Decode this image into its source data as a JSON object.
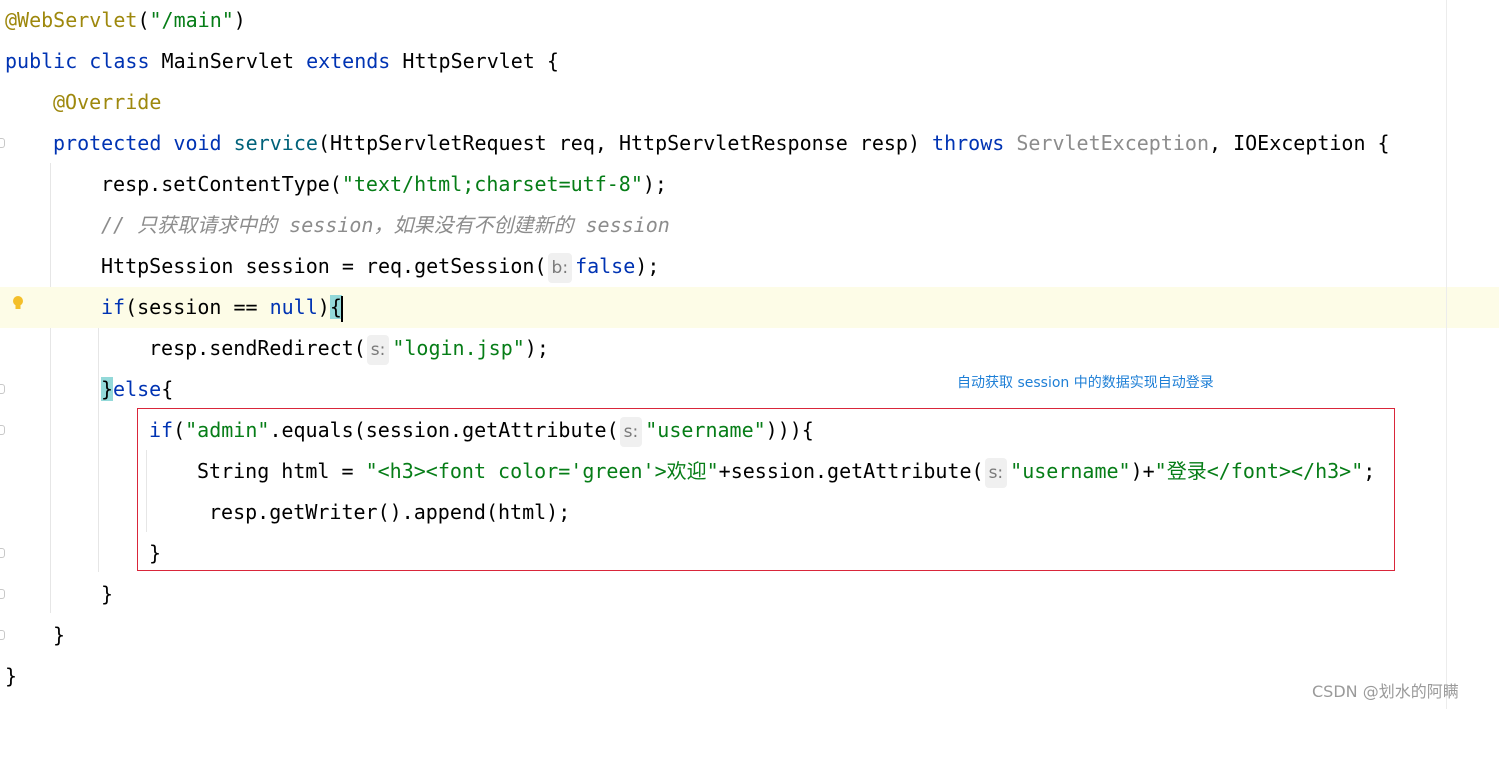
{
  "code": {
    "l1_annotation": "@WebServlet",
    "l1_paren_open": "(",
    "l1_string": "\"/main\"",
    "l1_paren_close": ")",
    "l2_public": "public",
    "l2_class": "class",
    "l2_name": " MainServlet ",
    "l2_extends": "extends",
    "l2_rest": " HttpServlet {",
    "l3_override": "@Override",
    "l4_protected": "protected",
    "l4_void": "void",
    "l4_method": "service",
    "l4_params": "(HttpServletRequest req, HttpServletResponse resp) ",
    "l4_throws": "throws",
    "l4_servlet_exception": "ServletException",
    "l4_rest": ", IOException {",
    "l5_call": "resp.setContentType(",
    "l5_string": "\"text/html;charset=utf-8\"",
    "l5_end": ");",
    "l6_comment": "// 只获取请求中的 session，如果没有不创建新的 session",
    "l7_start": "HttpSession session = req.getSession(",
    "l7_hint": "b:",
    "l7_false": "false",
    "l7_end": ");",
    "l8_if": "if",
    "l8_cond": "(session == ",
    "l8_null": "null",
    "l8_close": ")",
    "l8_brace": "{",
    "l9_call": "resp.sendRedirect(",
    "l9_hint": "s:",
    "l9_string": "\"login.jsp\"",
    "l9_end": ");",
    "l10_brace": "}",
    "l10_else": "else",
    "l10_open": "{",
    "l11_if": "if",
    "l11_paren": "(",
    "l11_string": "\"admin\"",
    "l11_call": ".equals(session.getAttribute(",
    "l11_hint": "s:",
    "l11_arg": "\"username\"",
    "l11_end": "))){",
    "l12_start": "String html = ",
    "l12_string1": "\"<h3><font color='green'>欢迎\"",
    "l12_mid": "+session.getAttribute(",
    "l12_hint": "s:",
    "l12_arg": "\"username\"",
    "l12_plus": ")+",
    "l12_string2": "\"登录</font></h3>\"",
    "l12_end": ";",
    "l13": "resp.getWriter().append(html);",
    "l14": "}",
    "l15": "}",
    "l16": "}",
    "l17": "}"
  },
  "annotation_note": "自动获取 session 中的数据实现自动登录",
  "watermark": "CSDN @划水的阿瞒",
  "colors": {
    "keyword": "#0033b3",
    "string": "#067d17",
    "annotation": "#9e880d",
    "comment": "#8c8c8c",
    "current_line": "#fdfce7",
    "brace_match": "#93d9d9",
    "callout_border": "#d9263a",
    "callout_text": "#1e7fd6"
  },
  "icons": [
    "lightbulb-icon",
    "fold-marker-icon"
  ]
}
